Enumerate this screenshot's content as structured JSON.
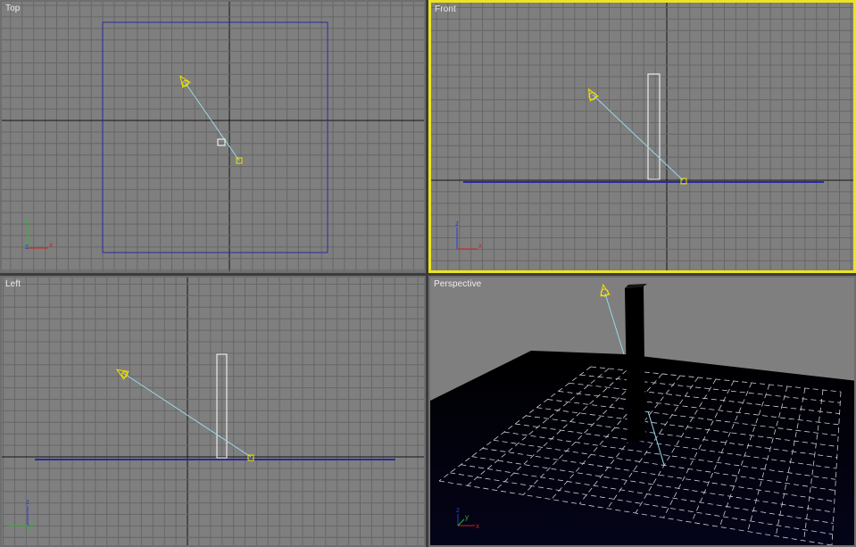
{
  "viewports": {
    "top": {
      "label": "Top",
      "active": false
    },
    "front": {
      "label": "Front",
      "active": true
    },
    "left": {
      "label": "Left",
      "active": false
    },
    "perspective": {
      "label": "Perspective",
      "active": false
    }
  },
  "axis_tripod": {
    "x": "x",
    "y": "y",
    "z": "z"
  },
  "colors": {
    "viewport_bg": "#7f7f7f",
    "grid_line": "#676767",
    "grid_axis": "#141414",
    "plane_outline": "#2a2aa0",
    "light_icon": "#f2e200",
    "light_target_line": "#9ad7e6",
    "box_wire": "#ffffff",
    "active_border": "#ece321",
    "axis_x": "#d22020",
    "axis_y": "#20c020",
    "axis_z": "#2040d0"
  },
  "scene_objects": [
    "plane",
    "box",
    "target-spot-light",
    "light-target"
  ]
}
